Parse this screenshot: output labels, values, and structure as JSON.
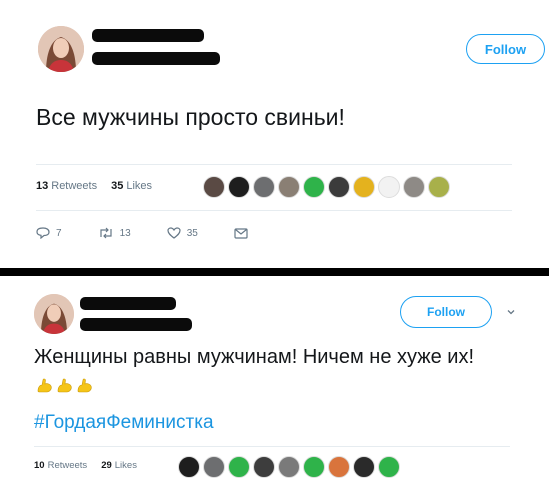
{
  "tweet1": {
    "follow_label": "Follow",
    "text": "Все мужчины просто свиньи!",
    "retweets_count": "13",
    "retweets_label": "Retweets",
    "likes_count": "35",
    "likes_label": "Likes",
    "reply_count": "7",
    "retweet_action_count": "13",
    "like_action_count": "35",
    "likers": [
      "#5a4a44",
      "#1e1e1e",
      "#6d6e70",
      "#8a7f74",
      "#2fb34a",
      "#3b3b3b",
      "#e4b21e",
      "#f2f2f2",
      "#8e8a86",
      "#a8b04a"
    ]
  },
  "tweet2": {
    "follow_label": "Follow",
    "text": "Женщины равны мужчинам! Ничем не хуже их!",
    "emoji_icon": "flexed-biceps-icon",
    "emoji_count": 3,
    "emoji_color": "#f5c518",
    "hashtag": "#ГордаяФеминистка",
    "retweets_count": "10",
    "retweets_label": "Retweets",
    "likes_count": "29",
    "likes_label": "Likes",
    "likers": [
      "#1e1e1e",
      "#6d6e70",
      "#2fb34a",
      "#3d3d3d",
      "#7a7a7a",
      "#2fb34a",
      "#d9743c",
      "#2a2a2a",
      "#2fb34a"
    ]
  },
  "colors": {
    "accent": "#1da1f2",
    "hashtag": "#1b95e0",
    "muted": "#657786"
  }
}
